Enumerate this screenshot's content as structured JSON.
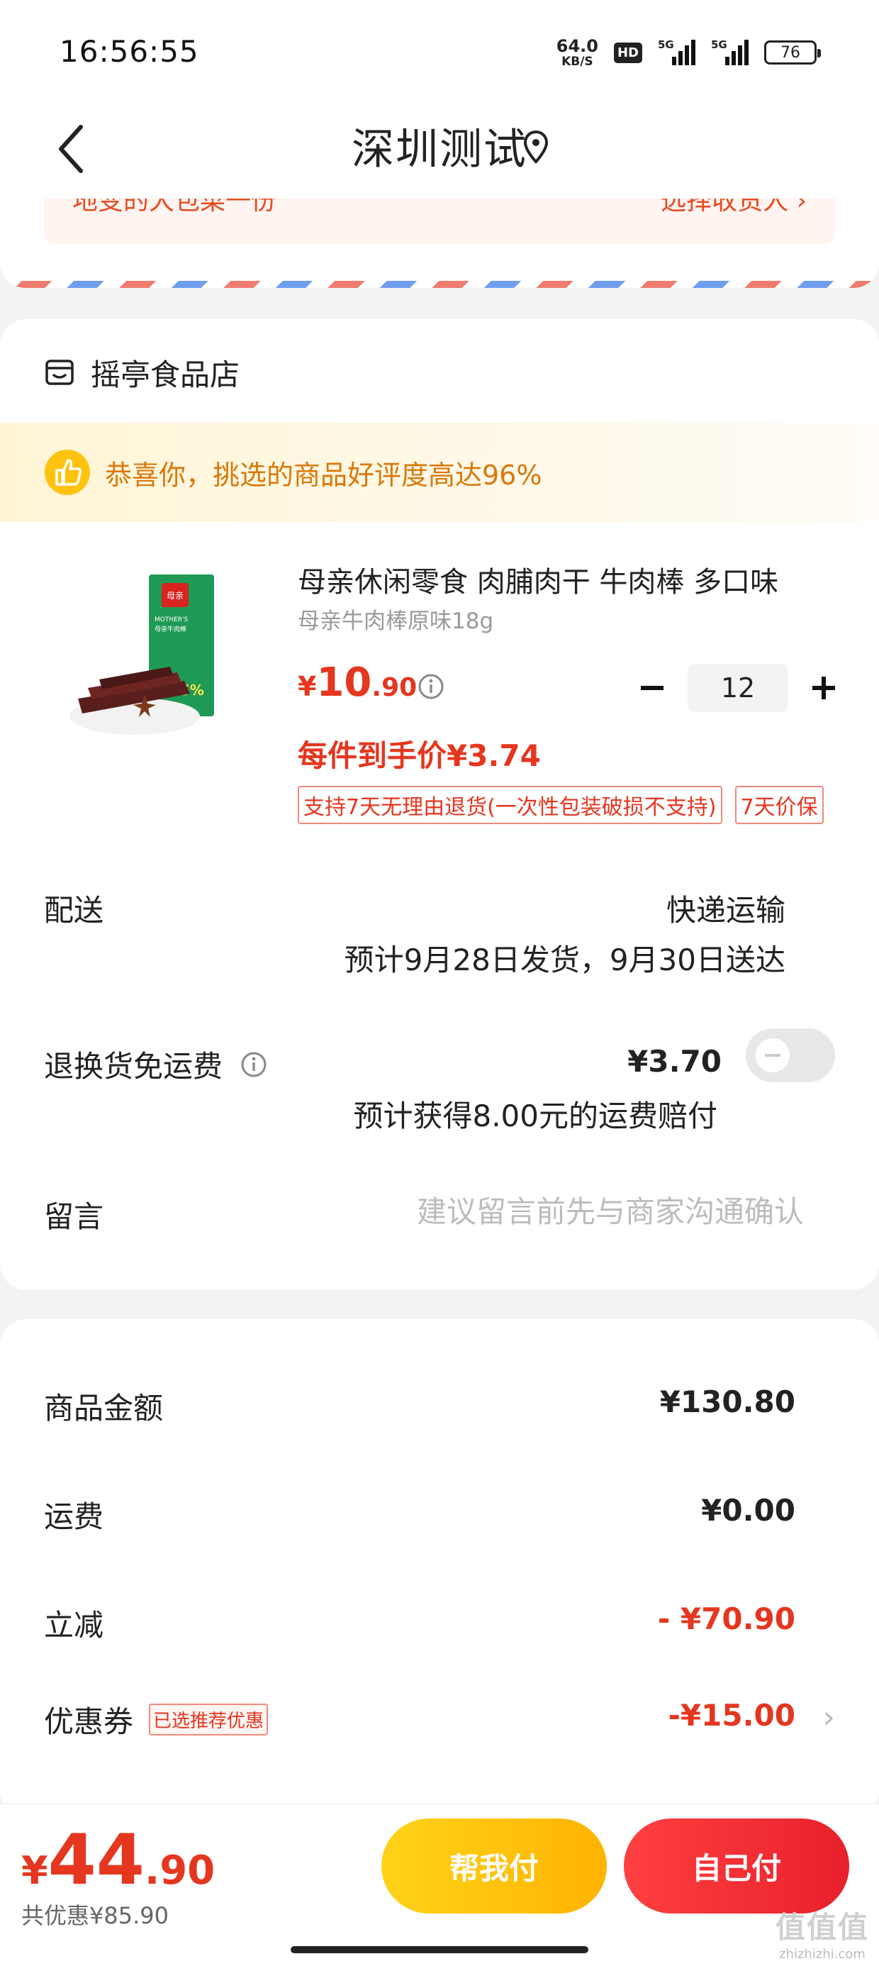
{
  "status_bar": {
    "time": "16:56:55",
    "net_speed_value": "64.0",
    "net_speed_unit": "KB/S",
    "hd_badge": "HD",
    "sig1_label": "5G",
    "sig2_label": "5G",
    "battery": "76"
  },
  "nav": {
    "title": "深圳测试"
  },
  "address": {
    "left_text": "地变的大包菜一份",
    "right_text": "选择收货人 ›"
  },
  "shop": {
    "name": "摇亭食品店",
    "praise_banner": "恭喜你，挑选的商品好评度高达96%"
  },
  "product": {
    "title": "母亲休闲零食 肉脯肉干 牛肉棒 多口味",
    "spec": "母亲牛肉棒原味18g",
    "price_symbol": "¥",
    "price_int": "10",
    "price_dec": ".90",
    "quantity": "12",
    "unit_price": "每件到手价¥3.74",
    "tags": [
      "支持7天无理由退货(一次性包装破损不支持)",
      "7天价保"
    ],
    "image_text": {
      "brand": "母亲",
      "name_en": "MOTHER'S",
      "name_cn": "母亲牛肉棒",
      "percent": "35%"
    }
  },
  "delivery": {
    "label": "配送",
    "method": "快递运输",
    "eta": "预计9月28日发货，9月30日送达"
  },
  "freight_insurance": {
    "label": "退换货免运费",
    "price": "¥3.70",
    "sub_text": "预计获得8.00元的运费赔付",
    "enabled": false
  },
  "message": {
    "label": "留言",
    "placeholder": "建议留言前先与商家沟通确认"
  },
  "summary": {
    "goods_label": "商品金额",
    "goods_value": "¥130.80",
    "shipping_label": "运费",
    "shipping_value": "¥0.00",
    "discount_label": "立减",
    "discount_value": "- ¥70.90",
    "coupon_label": "优惠券",
    "coupon_tag": "已选推荐优惠",
    "coupon_value": "-¥15.00"
  },
  "footer": {
    "total_symbol": "¥",
    "total_int": "44",
    "total_dec": ".90",
    "saved": "共优惠¥85.90",
    "help_pay": "帮我付",
    "self_pay": "自己付",
    "watermark_main": "值值值",
    "watermark_sub": "zhizhizhi.com"
  },
  "colors": {
    "accent_red": "#e5361f",
    "praise_orange": "#d9780a",
    "help_button": "#ffc20e",
    "self_button": "#f02a34"
  }
}
